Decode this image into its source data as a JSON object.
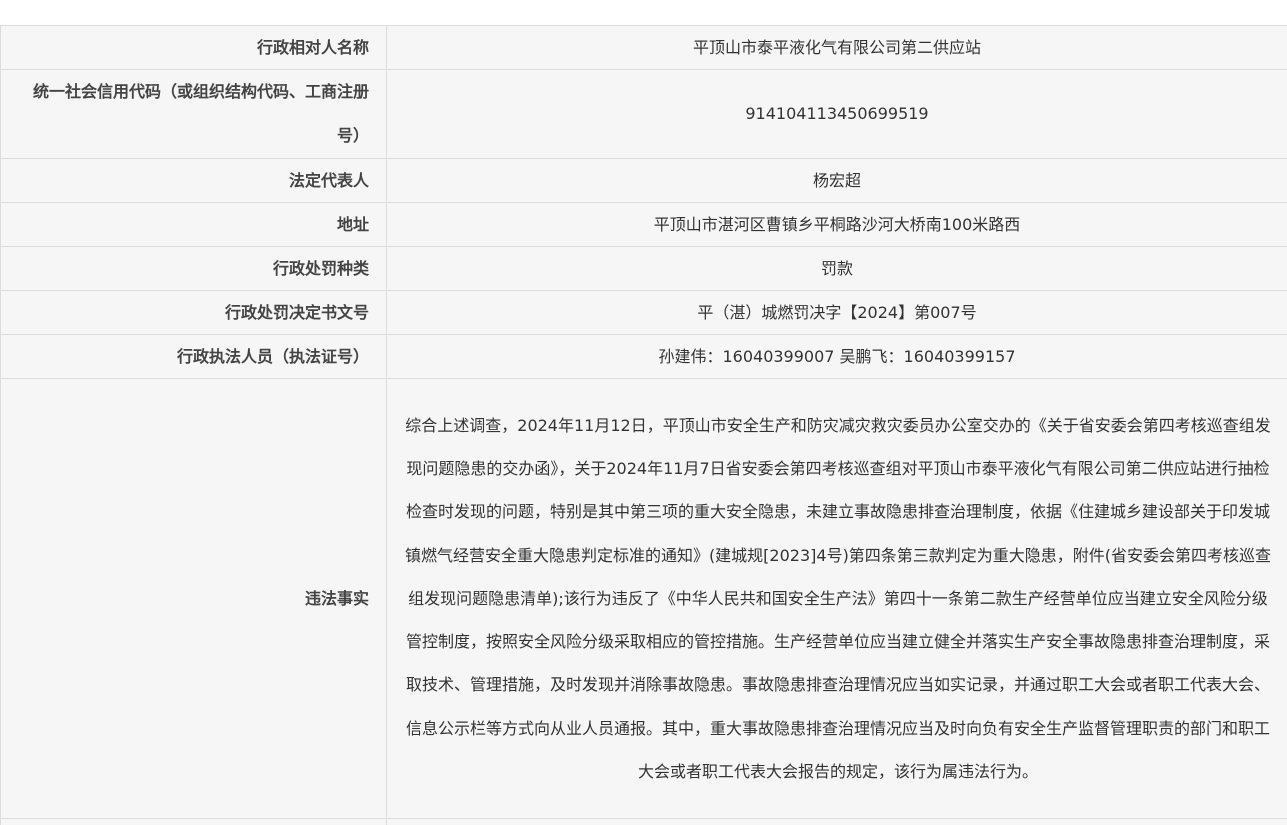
{
  "rows": [
    {
      "label": "行政相对人名称",
      "value": "平顶山市泰平液化气有限公司第二供应站"
    },
    {
      "label": "统一社会信用代码（或组织结构代码、工商注册号）",
      "value": "914104113450699519"
    },
    {
      "label": "法定代表人",
      "value": "杨宏超"
    },
    {
      "label": "地址",
      "value": "平顶山市湛河区曹镇乡平桐路沙河大桥南100米路西"
    },
    {
      "label": "行政处罚种类",
      "value": "罚款"
    },
    {
      "label": "行政处罚决定书文号",
      "value": "平（湛）城燃罚决字【2024】第007号"
    },
    {
      "label": "行政执法人员（执法证号）",
      "value": "孙建伟：16040399007 吴鹏飞：16040399157"
    },
    {
      "label": "违法事实",
      "value": "综合上述调查，2024年11月12日，平顶山市安全生产和防灾减灾救灾委员办公室交办的《关于省安委会第四考核巡查组发现问题隐患的交办函》，关于2024年11月7日省安委会第四考核巡查组对平顶山市泰平液化气有限公司第二供应站进行抽检检查时发现的问题，特别是其中第三项的重大安全隐患，未建立事故隐患排查治理制度，依据《住建城乡建设部关于印发城镇燃气经营安全重大隐患判定标准的通知》(建城规[2023]4号)第四条第三款判定为重大隐患，附件(省安委会第四考核巡查组发现问题隐患清单);该行为违反了《中华人民共和国安全生产法》第四十一条第二款生产经营单位应当建立安全风险分级管控制度，按照安全风险分级采取相应的管控措施。生产经营单位应当建立健全并落实生产安全事故隐患排查治理制度，采取技术、管理措施，及时发现并消除事故隐患。事故隐患排查治理情况应当如实记录，并通过职工大会或者职工代表大会、信息公示栏等方式向从业人员通报。其中，重大事故隐患排查治理情况应当及时向负有安全生产监督管理职责的部门和职工大会或者职工代表大会报告的规定，该行为属违法行为。"
    }
  ]
}
